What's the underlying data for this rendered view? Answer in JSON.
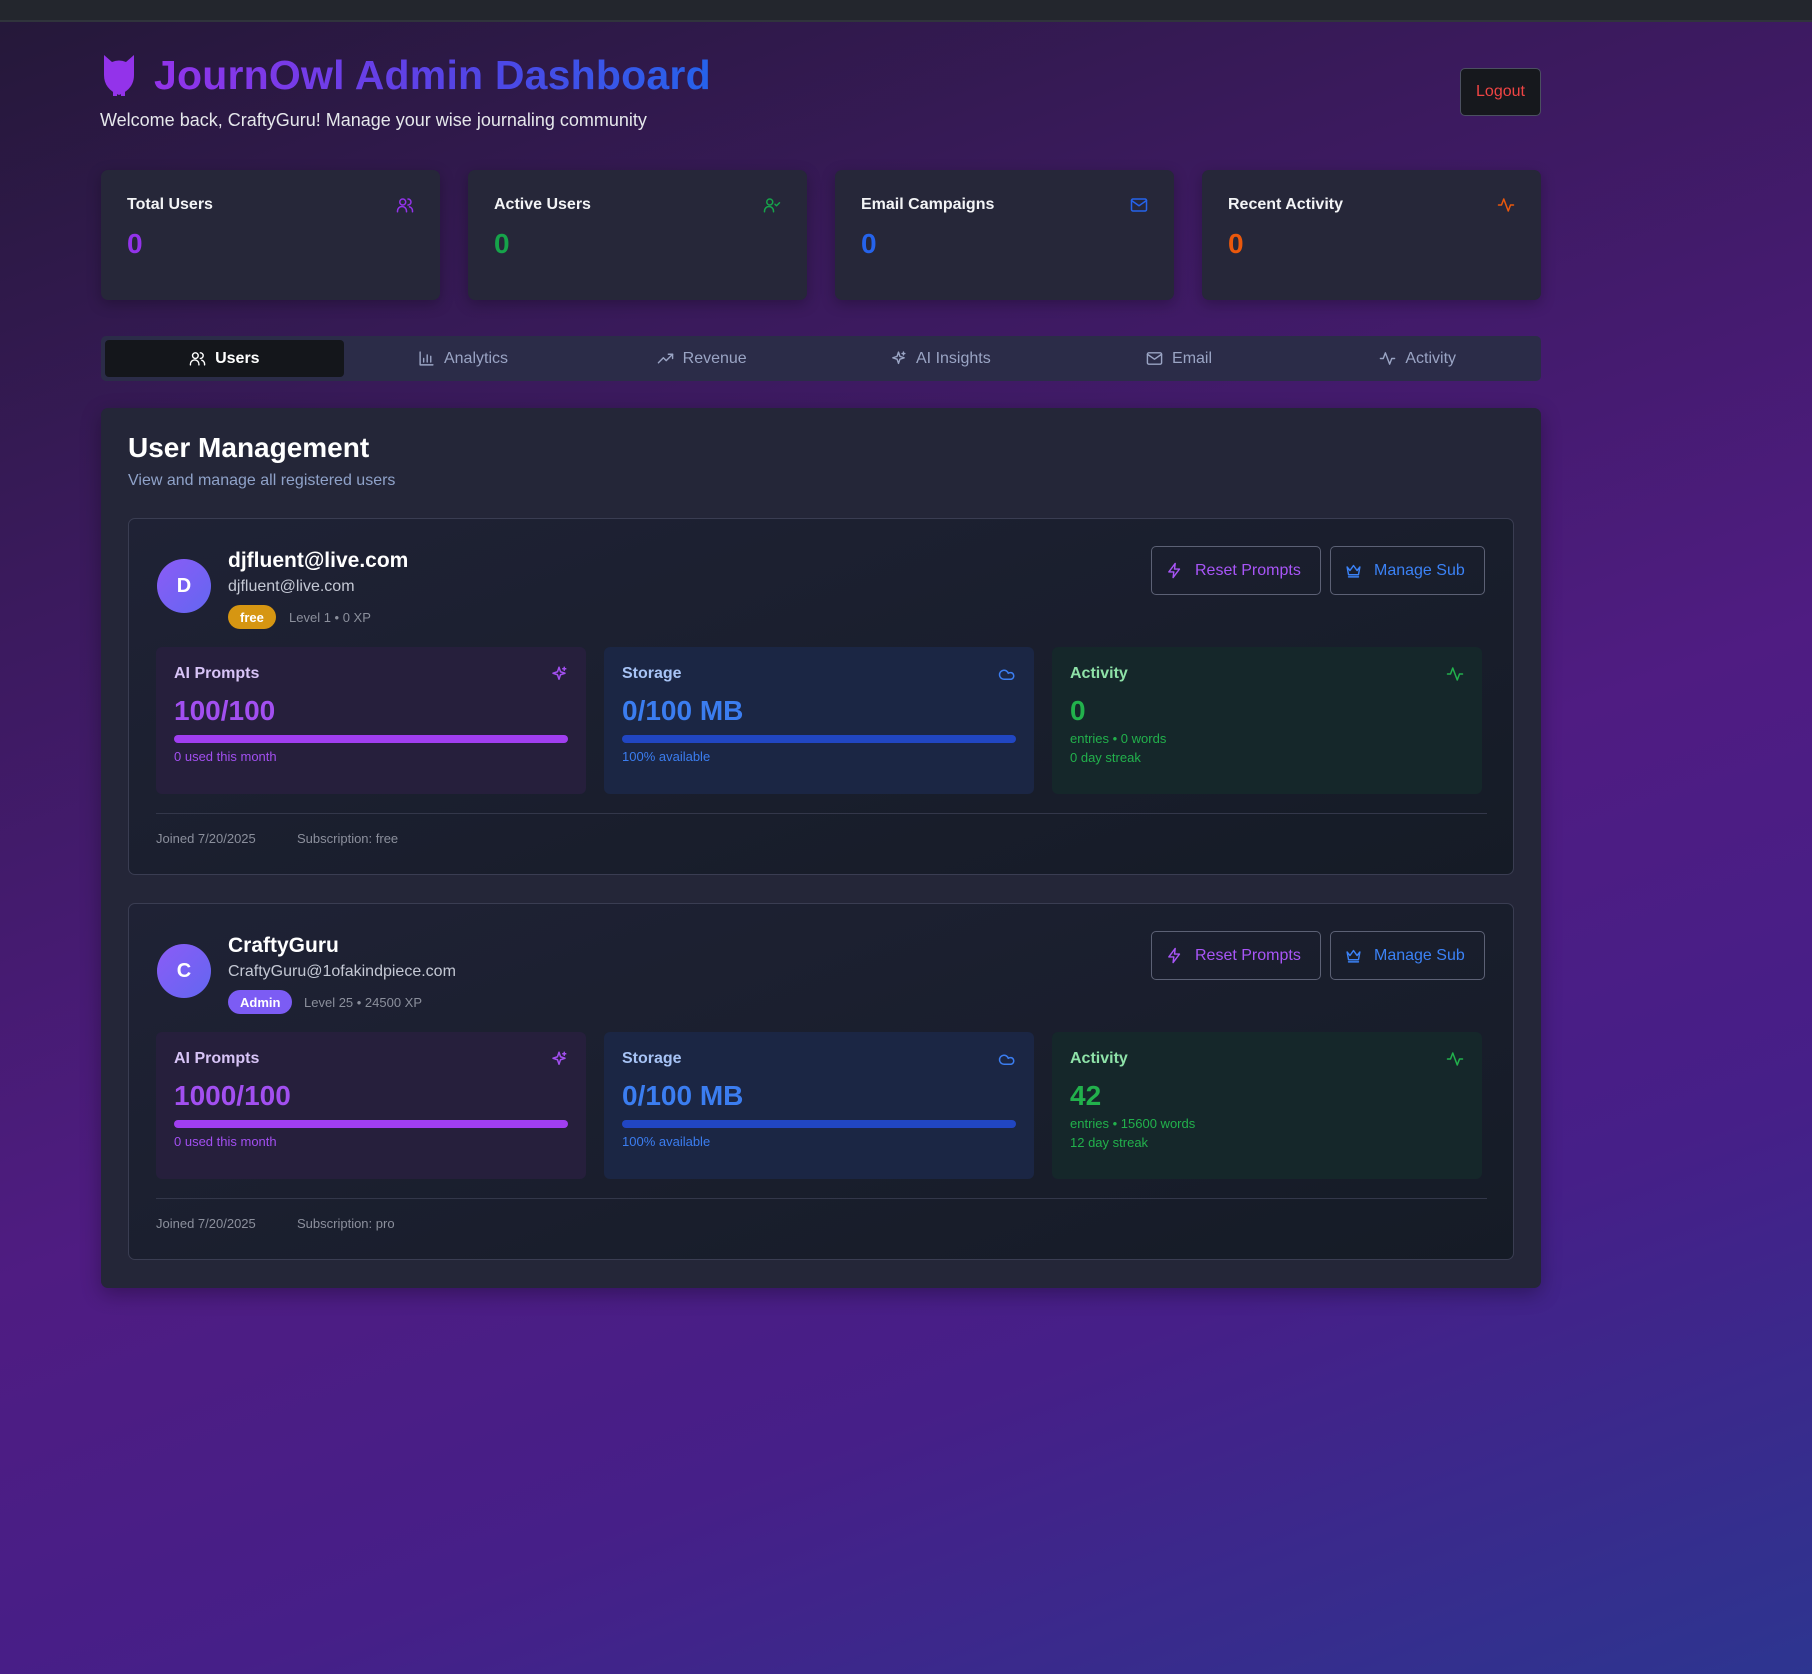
{
  "header": {
    "title": "JournOwl Admin Dashboard",
    "welcome": "Welcome back, CraftyGuru! Manage your wise journaling community",
    "logout_label": "Logout"
  },
  "stats": [
    {
      "title": "Total Users",
      "value": "0",
      "icon": "users-icon",
      "color": "#9333ea"
    },
    {
      "title": "Active Users",
      "value": "0",
      "icon": "user-check-icon",
      "color": "#16a34a"
    },
    {
      "title": "Email Campaigns",
      "value": "0",
      "icon": "mail-icon",
      "color": "#2563eb"
    },
    {
      "title": "Recent Activity",
      "value": "0",
      "icon": "activity-icon",
      "color": "#ea580c"
    }
  ],
  "tabs": [
    {
      "label": "Users",
      "icon": "users-icon",
      "active": true
    },
    {
      "label": "Analytics",
      "icon": "bar-chart-icon",
      "active": false
    },
    {
      "label": "Revenue",
      "icon": "trending-up-icon",
      "active": false
    },
    {
      "label": "AI Insights",
      "icon": "sparkles-icon",
      "active": false
    },
    {
      "label": "Email",
      "icon": "mail-icon",
      "active": false
    },
    {
      "label": "Activity",
      "icon": "activity-icon",
      "active": false
    }
  ],
  "panel": {
    "title": "User Management",
    "subtitle": "View and manage all registered users"
  },
  "users": [
    {
      "initial": "D",
      "name": "djfluent@live.com",
      "email": "djfluent@live.com",
      "badge": "free",
      "level": "Level 1 • 0 XP",
      "reset_label": "Reset Prompts",
      "sub_label": "Manage Sub",
      "ai": {
        "title": "AI Prompts",
        "value": "100/100",
        "progress": 1.0,
        "note": "0 used this month"
      },
      "storage": {
        "title": "Storage",
        "value": "0/100 MB",
        "progress": 1.0,
        "note": "100% available"
      },
      "activity": {
        "title": "Activity",
        "value": "0",
        "line1": "entries • 0 words",
        "line2": "0 day streak"
      },
      "joined": "Joined 7/20/2025",
      "subscription": "Subscription: free"
    },
    {
      "initial": "C",
      "name": "CraftyGuru",
      "email": "CraftyGuru@1ofakindpiece.com",
      "badge": "Admin",
      "level": "Level 25 • 24500 XP",
      "reset_label": "Reset Prompts",
      "sub_label": "Manage Sub",
      "ai": {
        "title": "AI Prompts",
        "value": "1000/100",
        "progress": 1.0,
        "note": "0 used this month"
      },
      "storage": {
        "title": "Storage",
        "value": "0/100 MB",
        "progress": 1.0,
        "note": "100% available"
      },
      "activity": {
        "title": "Activity",
        "value": "42",
        "line1": "entries • 15600 words",
        "line2": "12 day streak"
      },
      "joined": "Joined 7/20/2025",
      "subscription": "Subscription: pro"
    }
  ]
}
